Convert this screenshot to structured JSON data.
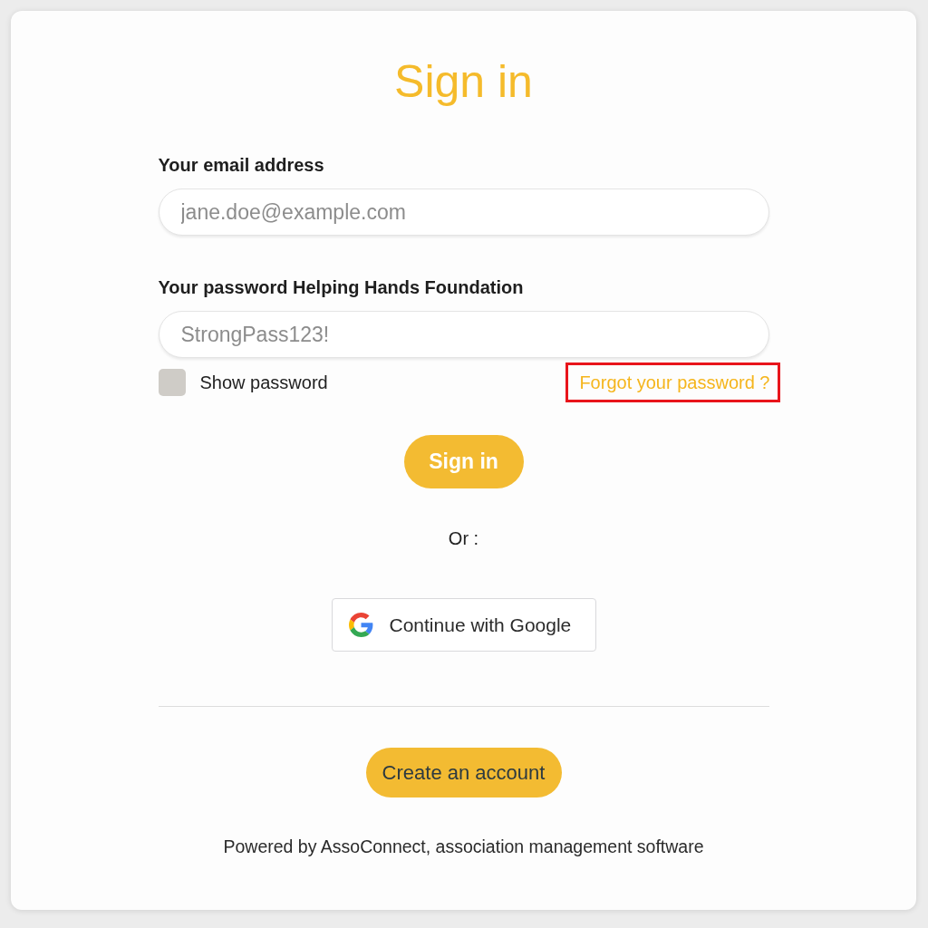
{
  "title": "Sign in",
  "fields": [
    {
      "label": "Your email address",
      "placeholder": "jane.doe@example.com"
    },
    {
      "label": "Your password Helping Hands Foundation",
      "placeholder": "StrongPass123!"
    }
  ],
  "show_password": {
    "label": "Show password",
    "checked": false
  },
  "forgot_link": {
    "label": "Forgot your password ?",
    "highlighted": true
  },
  "sign_in_button": "Sign in",
  "separator_text": "Or :",
  "google_button": "Continue with Google",
  "create_account_button": "Create an account",
  "footer": "Powered by AssoConnect, association management software"
}
